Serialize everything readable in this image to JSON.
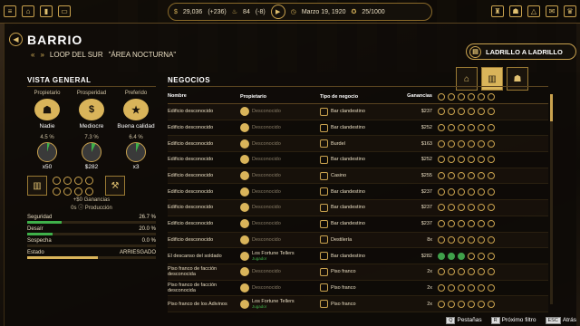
{
  "top": {
    "money": "29,036",
    "money_delta": "(+236)",
    "heat": "84",
    "heat_delta": "(-8)",
    "date": "Marzo 19, 1920",
    "rep": "25/1000"
  },
  "hood": "BARRIO",
  "district": "LOOP DEL SUR",
  "district_quote": "\"ÁREA NOCTURNA\"",
  "brick_label": "LADRILLO A LADRILLO",
  "overview": {
    "title": "VISTA GENERAL",
    "owner": {
      "label": "Propietario",
      "value": "Nadie",
      "pct": "4.5 %",
      "count": "x50"
    },
    "prosperity": {
      "label": "Prosperidad",
      "value": "Mediocre",
      "pct": "7.3 %",
      "count": "$282"
    },
    "preferred": {
      "label": "Preferido",
      "value": "Buena calidad",
      "pct": "6.4 %",
      "count": "x3"
    },
    "earnings": "+$0 Ganancias",
    "production": "0s ⓘ Producción",
    "stats": [
      {
        "label": "Seguridad",
        "value": "26.7 %",
        "fill": 0.267
      },
      {
        "label": "Desaír",
        "value": "20.0 %",
        "fill": 0.2
      },
      {
        "label": "Sospecha",
        "value": "0.0 %",
        "fill": 0
      },
      {
        "label": "Estado",
        "value": "ARRIESGADO",
        "fill": 0.55
      }
    ]
  },
  "business": {
    "title": "NEGOCIOS",
    "headers": {
      "name": "Nombre",
      "owner": "Propietario",
      "type": "Tipo de negocio",
      "earn": "Ganancias"
    },
    "rows": [
      {
        "name": "Edificio desconocido",
        "owner": "Desconocido",
        "type": "Bar clandestino",
        "earn": "$237",
        "on": []
      },
      {
        "name": "Edificio desconocido",
        "owner": "Desconocido",
        "type": "Bar clandestino",
        "earn": "$252",
        "on": []
      },
      {
        "name": "Edificio desconocido",
        "owner": "Desconocido",
        "type": "Burdel",
        "earn": "$163",
        "on": []
      },
      {
        "name": "Edificio desconocido",
        "owner": "Desconocido",
        "type": "Bar clandestino",
        "earn": "$252",
        "on": []
      },
      {
        "name": "Edificio desconocido",
        "owner": "Desconocido",
        "type": "Casino",
        "earn": "$255",
        "on": []
      },
      {
        "name": "Edificio desconocido",
        "owner": "Desconocido",
        "type": "Bar clandestino",
        "earn": "$237",
        "on": []
      },
      {
        "name": "Edificio desconocido",
        "owner": "Desconocido",
        "type": "Bar clandestino",
        "earn": "$237",
        "on": []
      },
      {
        "name": "Edificio desconocido",
        "owner": "Desconocido",
        "type": "Bar clandestino",
        "earn": "$237",
        "on": []
      },
      {
        "name": "Edificio desconocido",
        "owner": "Desconocido",
        "type": "Destilería",
        "earn": "8x",
        "on": []
      },
      {
        "name": "El descanso del soldado",
        "owner": "Los Fortune Tellers",
        "owner_sub": "Jugador",
        "type": "Bar clandestino",
        "earn": "$282",
        "on": [
          0,
          1,
          2
        ]
      },
      {
        "name": "Piso franco de facción desconocida",
        "owner": "Desconocido",
        "type": "Piso franco",
        "earn": "2x",
        "on": []
      },
      {
        "name": "Piso franco de facción desconocida",
        "owner": "Desconocido",
        "type": "Piso franco",
        "earn": "2x",
        "on": []
      },
      {
        "name": "Piso franco de los Adivinos",
        "owner": "Los Fortune Tellers",
        "owner_sub": "Jugador",
        "type": "Piso franco",
        "earn": "2x",
        "on": []
      }
    ]
  },
  "footer": {
    "tabs_key": "Q",
    "tabs": "Pestañas",
    "filter_key": "R",
    "filter": "Próximo filtro",
    "back_key": "ESC",
    "back": "Atrás"
  }
}
